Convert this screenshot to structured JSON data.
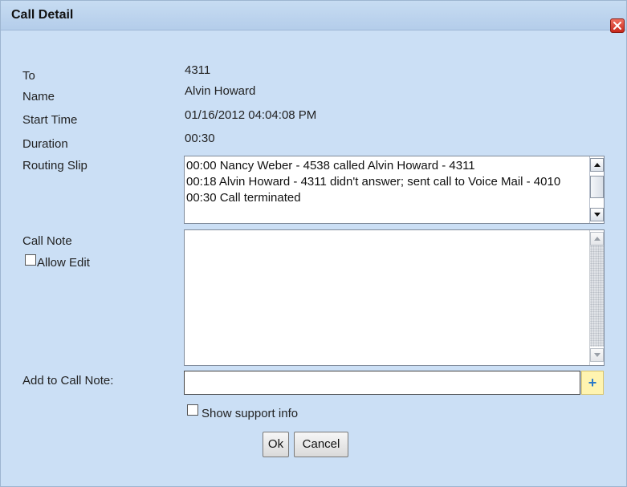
{
  "dialog": {
    "title": "Call Detail",
    "close_icon": "close-icon"
  },
  "fields": {
    "to_label": "To",
    "to_value": "4311",
    "name_label": "Name",
    "name_value": "Alvin Howard",
    "start_label": "Start Time",
    "start_value": "01/16/2012 04:04:08 PM",
    "duration_label": "Duration",
    "duration_value": "00:30",
    "routing_label": "Routing Slip"
  },
  "routing_slip": [
    "00:00 Nancy Weber - 4538 called Alvin Howard - 4311",
    "00:18 Alvin Howard - 4311 didn't answer; sent call to Voice Mail - 4010",
    "00:30 Call terminated"
  ],
  "call_note": {
    "label": "Call Note",
    "allow_edit_label": "Allow Edit",
    "allow_edit_checked": false,
    "text": ""
  },
  "add_note": {
    "label": "Add to Call Note:",
    "value": "",
    "add_icon": "plus-icon"
  },
  "support": {
    "label": "Show support info",
    "checked": false
  },
  "buttons": {
    "ok": "Ok",
    "cancel": "Cancel"
  },
  "colors": {
    "dialog_bg": "#cbdff5",
    "close_button": "#d9382a",
    "add_button_bg": "#fff4b0",
    "plus_icon": "#2a78c8"
  }
}
